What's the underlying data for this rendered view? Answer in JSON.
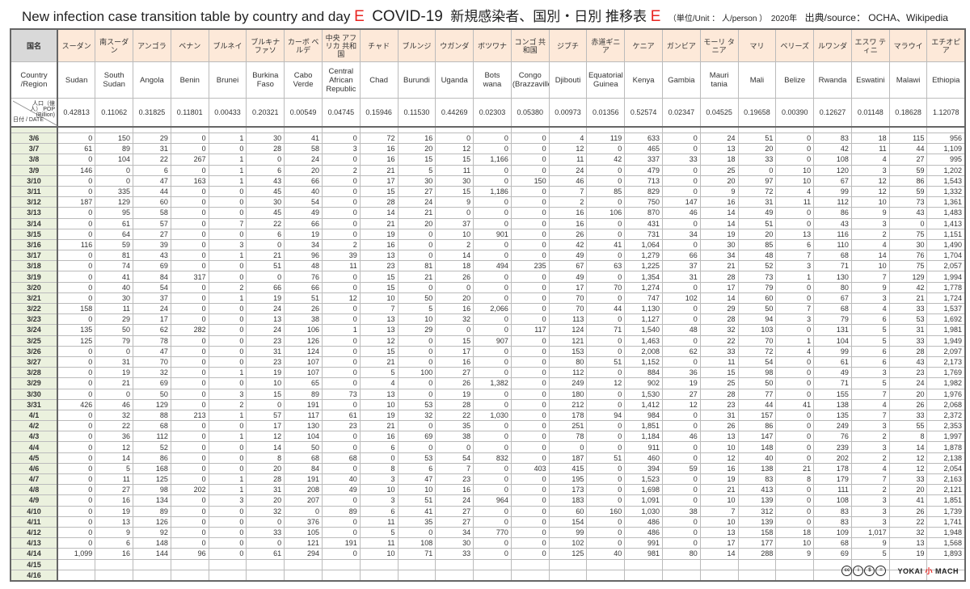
{
  "title": {
    "en": "New infection case transition table by country and day",
    "mark1": "E",
    "covid": "COVID-19",
    "jp": "新規感染者、国別・日別 推移表",
    "mark2": "E",
    "unit": "（単位/Unit ： 人/person ）",
    "year": "2020年",
    "source": "出典/source： OCHA、Wikipedia"
  },
  "header": {
    "corner_jp": "国名",
    "corner_en": "Country /Region",
    "pop_label_top": "人口（億人） POP (Billion)",
    "pop_label_bottom": "日付 / DATE"
  },
  "countries": [
    {
      "jp": "スーダン",
      "en": "Sudan",
      "pop": "0.42813"
    },
    {
      "jp": "南スーダン",
      "en": "South Sudan",
      "pop": "0.11062"
    },
    {
      "jp": "アンゴラ",
      "en": "Angola",
      "pop": "0.31825"
    },
    {
      "jp": "ベナン",
      "en": "Benin",
      "pop": "0.11801"
    },
    {
      "jp": "ブルネイ",
      "en": "Brunei",
      "pop": "0.00433"
    },
    {
      "jp": "ブルキナ ファソ",
      "en": "Burkina Faso",
      "pop": "0.20321"
    },
    {
      "jp": "カーボ ベルデ",
      "en": "Cabo Verde",
      "pop": "0.00549"
    },
    {
      "jp": "中央 アフリカ 共和国",
      "en": "Central African Republic",
      "pop": "0.04745"
    },
    {
      "jp": "チャド",
      "en": "Chad",
      "pop": "0.15946"
    },
    {
      "jp": "ブルンジ",
      "en": "Burundi",
      "pop": "0.11530"
    },
    {
      "jp": "ウガンダ",
      "en": "Uganda",
      "pop": "0.44269"
    },
    {
      "jp": "ボツワナ",
      "en": "Bots wana",
      "pop": "0.02303"
    },
    {
      "jp": "コンゴ 共和国",
      "en": "Congo (Brazzaville)",
      "pop": "0.05380"
    },
    {
      "jp": "ジブチ",
      "en": "Djibouti",
      "pop": "0.00973"
    },
    {
      "jp": "赤道ギニア",
      "en": "Equatorial Guinea",
      "pop": "0.01356"
    },
    {
      "jp": "ケニア",
      "en": "Kenya",
      "pop": "0.52574"
    },
    {
      "jp": "ガンビア",
      "en": "Gambia",
      "pop": "0.02347"
    },
    {
      "jp": "モーリ タニア",
      "en": "Mauri tania",
      "pop": "0.04525"
    },
    {
      "jp": "マリ",
      "en": "Mali",
      "pop": "0.19658"
    },
    {
      "jp": "ベリーズ",
      "en": "Belize",
      "pop": "0.00390"
    },
    {
      "jp": "ルワンダ",
      "en": "Rwanda",
      "pop": "0.12627"
    },
    {
      "jp": "エスワ ティニ",
      "en": "Eswatini",
      "pop": "0.01148"
    },
    {
      "jp": "マラウイ",
      "en": "Malawi",
      "pop": "0.18628"
    },
    {
      "jp": "エチオピア",
      "en": "Ethiopia",
      "pop": "1.12078"
    }
  ],
  "rows": [
    {
      "date": "3/6",
      "v": [
        "0",
        "150",
        "29",
        "0",
        "1",
        "30",
        "41",
        "0",
        "72",
        "16",
        "0",
        "0",
        "0",
        "4",
        "119",
        "633",
        "0",
        "24",
        "51",
        "0",
        "83",
        "18",
        "115",
        "956"
      ]
    },
    {
      "date": "3/7",
      "v": [
        "61",
        "89",
        "31",
        "0",
        "0",
        "28",
        "58",
        "3",
        "16",
        "20",
        "12",
        "0",
        "0",
        "12",
        "0",
        "465",
        "0",
        "13",
        "20",
        "0",
        "42",
        "11",
        "44",
        "1,109"
      ]
    },
    {
      "date": "3/8",
      "v": [
        "0",
        "104",
        "22",
        "267",
        "1",
        "0",
        "24",
        "0",
        "16",
        "15",
        "15",
        "1,166",
        "0",
        "11",
        "42",
        "337",
        "33",
        "18",
        "33",
        "0",
        "108",
        "4",
        "27",
        "995"
      ]
    },
    {
      "date": "3/9",
      "v": [
        "146",
        "0",
        "6",
        "0",
        "1",
        "6",
        "20",
        "2",
        "21",
        "5",
        "11",
        "0",
        "0",
        "24",
        "0",
        "479",
        "0",
        "25",
        "0",
        "10",
        "120",
        "3",
        "59",
        "1,202"
      ]
    },
    {
      "date": "3/10",
      "v": [
        "0",
        "0",
        "47",
        "163",
        "1",
        "43",
        "66",
        "0",
        "17",
        "30",
        "30",
        "0",
        "150",
        "46",
        "0",
        "713",
        "0",
        "20",
        "97",
        "10",
        "67",
        "12",
        "86",
        "1,543"
      ]
    },
    {
      "date": "3/11",
      "v": [
        "0",
        "335",
        "44",
        "0",
        "0",
        "45",
        "40",
        "0",
        "15",
        "27",
        "15",
        "1,186",
        "0",
        "7",
        "85",
        "829",
        "0",
        "9",
        "72",
        "4",
        "99",
        "12",
        "59",
        "1,332"
      ]
    },
    {
      "date": "3/12",
      "v": [
        "187",
        "129",
        "60",
        "0",
        "0",
        "30",
        "54",
        "0",
        "28",
        "24",
        "9",
        "0",
        "0",
        "2",
        "0",
        "750",
        "147",
        "16",
        "31",
        "11",
        "112",
        "10",
        "73",
        "1,361"
      ]
    },
    {
      "date": "3/13",
      "v": [
        "0",
        "95",
        "58",
        "0",
        "0",
        "45",
        "49",
        "0",
        "14",
        "21",
        "0",
        "0",
        "0",
        "16",
        "106",
        "870",
        "46",
        "14",
        "49",
        "0",
        "86",
        "9",
        "43",
        "1,483"
      ]
    },
    {
      "date": "3/14",
      "v": [
        "0",
        "61",
        "57",
        "0",
        "7",
        "22",
        "66",
        "0",
        "21",
        "20",
        "37",
        "0",
        "0",
        "16",
        "0",
        "431",
        "0",
        "14",
        "51",
        "0",
        "43",
        "3",
        "0",
        "1,413"
      ]
    },
    {
      "date": "3/15",
      "v": [
        "0",
        "64",
        "27",
        "0",
        "0",
        "6",
        "19",
        "0",
        "19",
        "0",
        "10",
        "901",
        "0",
        "26",
        "0",
        "731",
        "34",
        "19",
        "20",
        "13",
        "116",
        "2",
        "75",
        "1,151"
      ]
    },
    {
      "date": "3/16",
      "v": [
        "116",
        "59",
        "39",
        "0",
        "3",
        "0",
        "34",
        "2",
        "16",
        "0",
        "2",
        "0",
        "0",
        "42",
        "41",
        "1,064",
        "0",
        "30",
        "85",
        "6",
        "110",
        "4",
        "30",
        "1,490"
      ]
    },
    {
      "date": "3/17",
      "v": [
        "0",
        "81",
        "43",
        "0",
        "1",
        "21",
        "96",
        "39",
        "13",
        "0",
        "14",
        "0",
        "0",
        "49",
        "0",
        "1,279",
        "66",
        "34",
        "48",
        "7",
        "68",
        "14",
        "76",
        "1,704"
      ]
    },
    {
      "date": "3/18",
      "v": [
        "0",
        "74",
        "69",
        "0",
        "0",
        "51",
        "48",
        "11",
        "23",
        "81",
        "18",
        "494",
        "235",
        "67",
        "63",
        "1,225",
        "37",
        "21",
        "52",
        "3",
        "71",
        "10",
        "75",
        "2,057"
      ]
    },
    {
      "date": "3/19",
      "v": [
        "0",
        "41",
        "84",
        "317",
        "0",
        "0",
        "76",
        "0",
        "15",
        "21",
        "26",
        "0",
        "0",
        "49",
        "0",
        "1,354",
        "31",
        "28",
        "73",
        "1",
        "130",
        "7",
        "129",
        "1,994"
      ]
    },
    {
      "date": "3/20",
      "v": [
        "0",
        "40",
        "54",
        "0",
        "2",
        "66",
        "66",
        "0",
        "15",
        "0",
        "0",
        "0",
        "0",
        "17",
        "70",
        "1,274",
        "0",
        "17",
        "79",
        "0",
        "80",
        "9",
        "42",
        "1,778"
      ]
    },
    {
      "date": "3/21",
      "v": [
        "0",
        "30",
        "37",
        "0",
        "1",
        "19",
        "51",
        "12",
        "10",
        "50",
        "20",
        "0",
        "0",
        "70",
        "0",
        "747",
        "102",
        "14",
        "60",
        "0",
        "67",
        "3",
        "21",
        "1,724"
      ]
    },
    {
      "date": "3/22",
      "v": [
        "158",
        "11",
        "24",
        "0",
        "0",
        "24",
        "26",
        "0",
        "7",
        "5",
        "16",
        "2,066",
        "0",
        "70",
        "44",
        "1,130",
        "0",
        "29",
        "50",
        "7",
        "68",
        "4",
        "33",
        "1,537"
      ]
    },
    {
      "date": "3/23",
      "v": [
        "0",
        "29",
        "17",
        "0",
        "0",
        "13",
        "38",
        "0",
        "13",
        "10",
        "32",
        "0",
        "0",
        "113",
        "0",
        "1,127",
        "0",
        "28",
        "94",
        "3",
        "79",
        "6",
        "53",
        "1,692"
      ]
    },
    {
      "date": "3/24",
      "v": [
        "135",
        "50",
        "62",
        "282",
        "0",
        "24",
        "106",
        "1",
        "13",
        "29",
        "0",
        "0",
        "117",
        "124",
        "71",
        "1,540",
        "48",
        "32",
        "103",
        "0",
        "131",
        "5",
        "31",
        "1,981"
      ]
    },
    {
      "date": "3/25",
      "v": [
        "125",
        "79",
        "78",
        "0",
        "0",
        "23",
        "126",
        "0",
        "12",
        "0",
        "15",
        "907",
        "0",
        "121",
        "0",
        "1,463",
        "0",
        "22",
        "70",
        "1",
        "104",
        "5",
        "33",
        "1,949"
      ]
    },
    {
      "date": "3/26",
      "v": [
        "0",
        "0",
        "47",
        "0",
        "0",
        "31",
        "124",
        "0",
        "15",
        "0",
        "17",
        "0",
        "0",
        "153",
        "0",
        "2,008",
        "62",
        "33",
        "72",
        "4",
        "99",
        "6",
        "28",
        "2,097"
      ]
    },
    {
      "date": "3/27",
      "v": [
        "0",
        "31",
        "70",
        "0",
        "0",
        "23",
        "107",
        "0",
        "21",
        "0",
        "16",
        "0",
        "0",
        "80",
        "51",
        "1,152",
        "0",
        "11",
        "54",
        "0",
        "61",
        "6",
        "43",
        "2,173"
      ]
    },
    {
      "date": "3/28",
      "v": [
        "0",
        "19",
        "32",
        "0",
        "1",
        "19",
        "107",
        "0",
        "5",
        "100",
        "27",
        "0",
        "0",
        "112",
        "0",
        "884",
        "36",
        "15",
        "98",
        "0",
        "49",
        "3",
        "23",
        "1,769"
      ]
    },
    {
      "date": "3/29",
      "v": [
        "0",
        "21",
        "69",
        "0",
        "0",
        "10",
        "65",
        "0",
        "4",
        "0",
        "26",
        "1,382",
        "0",
        "249",
        "12",
        "902",
        "19",
        "25",
        "50",
        "0",
        "71",
        "5",
        "24",
        "1,982"
      ]
    },
    {
      "date": "3/30",
      "v": [
        "0",
        "0",
        "50",
        "0",
        "3",
        "15",
        "89",
        "73",
        "13",
        "0",
        "19",
        "0",
        "0",
        "180",
        "0",
        "1,530",
        "27",
        "28",
        "77",
        "0",
        "155",
        "7",
        "20",
        "1,976"
      ]
    },
    {
      "date": "3/31",
      "v": [
        "426",
        "46",
        "129",
        "0",
        "2",
        "0",
        "191",
        "0",
        "10",
        "53",
        "28",
        "0",
        "0",
        "212",
        "0",
        "1,412",
        "12",
        "23",
        "44",
        "41",
        "138",
        "4",
        "26",
        "2,068"
      ]
    },
    {
      "date": "4/1",
      "v": [
        "0",
        "32",
        "88",
        "213",
        "1",
        "57",
        "117",
        "61",
        "19",
        "32",
        "22",
        "1,030",
        "0",
        "178",
        "94",
        "984",
        "0",
        "31",
        "157",
        "0",
        "135",
        "7",
        "33",
        "2,372"
      ]
    },
    {
      "date": "4/2",
      "v": [
        "0",
        "22",
        "68",
        "0",
        "0",
        "17",
        "130",
        "23",
        "21",
        "0",
        "35",
        "0",
        "0",
        "251",
        "0",
        "1,851",
        "0",
        "26",
        "86",
        "0",
        "249",
        "3",
        "55",
        "2,353"
      ]
    },
    {
      "date": "4/3",
      "v": [
        "0",
        "36",
        "112",
        "0",
        "1",
        "12",
        "104",
        "0",
        "16",
        "69",
        "38",
        "0",
        "0",
        "78",
        "0",
        "1,184",
        "46",
        "13",
        "147",
        "0",
        "76",
        "2",
        "8",
        "1,997"
      ]
    },
    {
      "date": "4/4",
      "v": [
        "0",
        "12",
        "52",
        "0",
        "0",
        "14",
        "50",
        "0",
        "6",
        "0",
        "0",
        "0",
        "0",
        "0",
        "0",
        "911",
        "0",
        "10",
        "148",
        "0",
        "239",
        "3",
        "14",
        "1,878"
      ]
    },
    {
      "date": "4/5",
      "v": [
        "0",
        "14",
        "86",
        "0",
        "0",
        "8",
        "68",
        "68",
        "0",
        "53",
        "54",
        "832",
        "0",
        "187",
        "51",
        "460",
        "0",
        "12",
        "40",
        "0",
        "202",
        "2",
        "12",
        "2,138"
      ]
    },
    {
      "date": "4/6",
      "v": [
        "0",
        "5",
        "168",
        "0",
        "0",
        "20",
        "84",
        "0",
        "8",
        "6",
        "7",
        "0",
        "403",
        "415",
        "0",
        "394",
        "59",
        "16",
        "138",
        "21",
        "178",
        "4",
        "12",
        "2,054"
      ]
    },
    {
      "date": "4/7",
      "v": [
        "0",
        "11",
        "125",
        "0",
        "1",
        "28",
        "191",
        "40",
        "3",
        "47",
        "23",
        "0",
        "0",
        "195",
        "0",
        "1,523",
        "0",
        "19",
        "83",
        "8",
        "179",
        "7",
        "33",
        "2,163"
      ]
    },
    {
      "date": "4/8",
      "v": [
        "0",
        "27",
        "98",
        "202",
        "1",
        "31",
        "208",
        "49",
        "10",
        "10",
        "16",
        "0",
        "0",
        "173",
        "0",
        "1,698",
        "0",
        "21",
        "413",
        "0",
        "111",
        "2",
        "20",
        "2,121"
      ]
    },
    {
      "date": "4/9",
      "v": [
        "0",
        "16",
        "134",
        "0",
        "3",
        "20",
        "207",
        "0",
        "3",
        "51",
        "24",
        "964",
        "0",
        "183",
        "0",
        "1,091",
        "0",
        "10",
        "139",
        "0",
        "108",
        "3",
        "41",
        "1,851"
      ]
    },
    {
      "date": "4/10",
      "v": [
        "0",
        "19",
        "89",
        "0",
        "0",
        "32",
        "0",
        "89",
        "6",
        "41",
        "27",
        "0",
        "0",
        "60",
        "160",
        "1,030",
        "38",
        "7",
        "312",
        "0",
        "83",
        "3",
        "26",
        "1,739"
      ]
    },
    {
      "date": "4/11",
      "v": [
        "0",
        "13",
        "126",
        "0",
        "0",
        "0",
        "376",
        "0",
        "11",
        "35",
        "27",
        "0",
        "0",
        "154",
        "0",
        "486",
        "0",
        "10",
        "139",
        "0",
        "83",
        "3",
        "22",
        "1,741"
      ]
    },
    {
      "date": "4/12",
      "v": [
        "0",
        "9",
        "92",
        "0",
        "0",
        "33",
        "105",
        "0",
        "5",
        "0",
        "34",
        "770",
        "0",
        "99",
        "0",
        "486",
        "0",
        "13",
        "158",
        "18",
        "109",
        "1,017",
        "32",
        "1,948"
      ]
    },
    {
      "date": "4/13",
      "v": [
        "0",
        "6",
        "148",
        "0",
        "0",
        "0",
        "121",
        "191",
        "11",
        "108",
        "30",
        "0",
        "0",
        "102",
        "0",
        "991",
        "0",
        "17",
        "177",
        "10",
        "68",
        "9",
        "13",
        "1,568"
      ]
    },
    {
      "date": "4/14",
      "v": [
        "1,099",
        "16",
        "144",
        "96",
        "0",
        "61",
        "294",
        "0",
        "10",
        "71",
        "33",
        "0",
        "0",
        "125",
        "40",
        "981",
        "80",
        "14",
        "288",
        "9",
        "69",
        "5",
        "19",
        "1,893"
      ]
    },
    {
      "date": "4/15",
      "v": []
    },
    {
      "date": "4/16",
      "v": []
    }
  ],
  "footer": {
    "license_icons": [
      "cc-icon",
      "by-icon",
      "nc-icon",
      "nd-icon"
    ],
    "logo_text": "YOKAI 小 MACH"
  },
  "colors": {
    "accent": "#e8231f",
    "header_jp_bg": "#fde9d9",
    "corner_bg": "#d9d9d9",
    "date_bg": "#ebf1de"
  }
}
